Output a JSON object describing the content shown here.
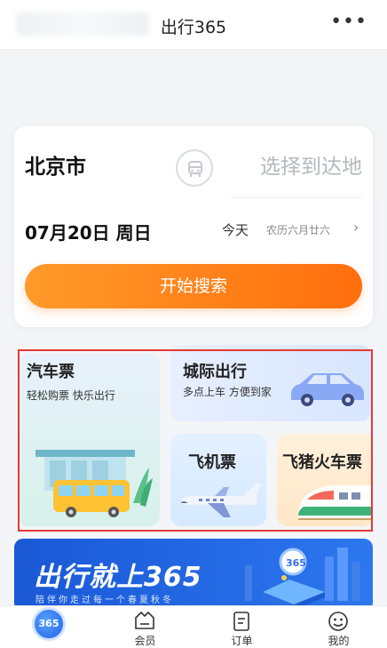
{
  "header": {
    "title": "出行365",
    "more_label": "•••"
  },
  "search": {
    "from_city": "北京市",
    "to_placeholder": "选择到达地",
    "date": "07月20日 周日",
    "today": "今天",
    "lunar": "农历六月廿六",
    "search_button": "开始搜索"
  },
  "tiles": {
    "bus": {
      "title": "汽车票",
      "subtitle": "轻松购票  快乐出行"
    },
    "intercity": {
      "title": "城际出行",
      "subtitle": "多点上车 方便到家"
    },
    "plane": {
      "title": "飞机票"
    },
    "train": {
      "title": "飞猪火车票"
    }
  },
  "banner": {
    "title": "出行就上365",
    "subtitle": "陪伴你走过每一个春夏秋冬"
  },
  "tabbar": {
    "items": [
      {
        "label": "",
        "logo": "365"
      },
      {
        "label": "会员"
      },
      {
        "label": "订单"
      },
      {
        "label": "我的"
      }
    ]
  }
}
